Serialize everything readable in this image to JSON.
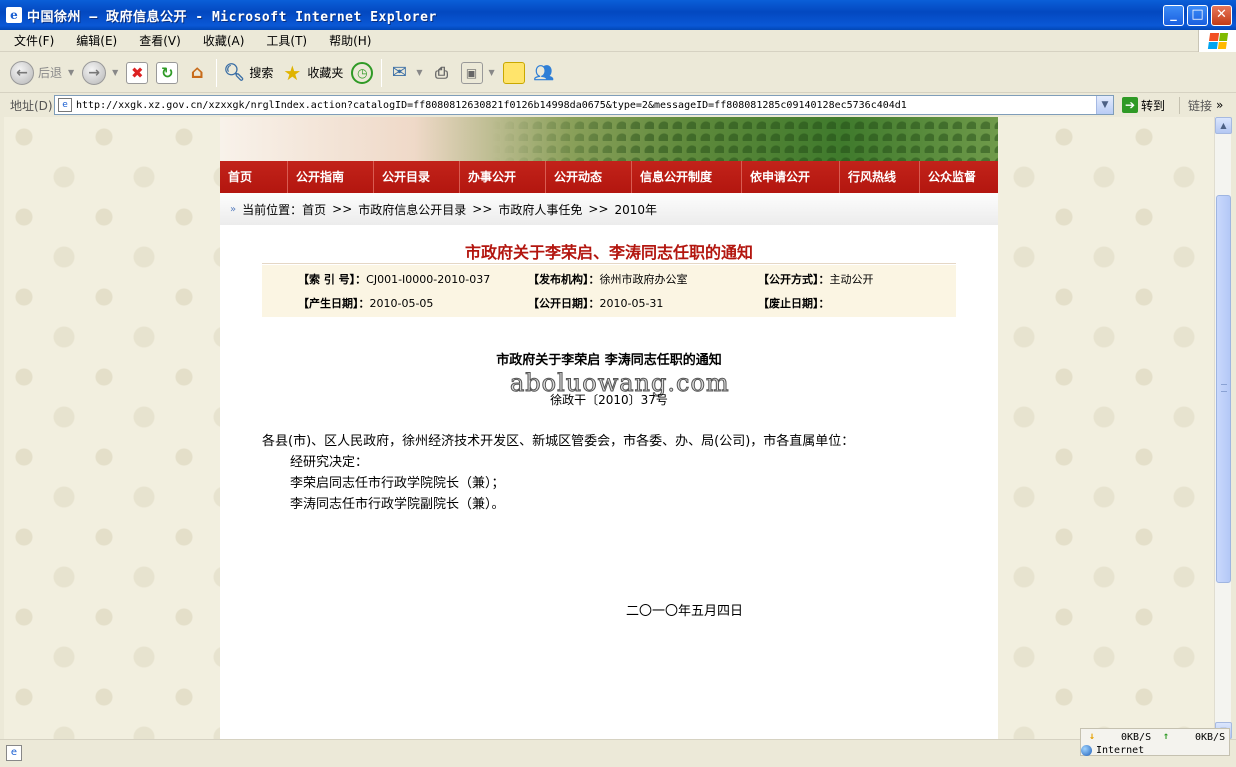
{
  "window": {
    "title": "中国徐州 — 政府信息公开 - Microsoft Internet Explorer"
  },
  "menu": [
    "文件(F)",
    "编辑(E)",
    "查看(V)",
    "收藏(A)",
    "工具(T)",
    "帮助(H)"
  ],
  "toolbar": {
    "back": "后退",
    "search": "搜索",
    "favorites": "收藏夹"
  },
  "address": {
    "label": "地址(D)",
    "url": "http://xxgk.xz.gov.cn/xzxxgk/nrglIndex.action?catalogID=ff8080812630821f0126b14998da0675&type=2&messageID=ff808081285c09140128ec5736c404d1",
    "go": "转到",
    "links": "链接"
  },
  "nav": [
    "首页",
    "公开指南",
    "公开目录",
    "办事公开",
    "公开动态",
    "信息公开制度",
    "依申请公开",
    "行风热线",
    "公众监督"
  ],
  "breadcrumb": {
    "prefix": "当前位置：",
    "items": [
      "首页",
      ">>",
      "市政府信息公开目录",
      ">>",
      "市政府人事任免",
      ">>",
      "2010年"
    ]
  },
  "document": {
    "title": "市政府关于李荣启、李涛同志任职的通知",
    "meta": {
      "index_label": "【索 引 号】：",
      "index_value": "CJ001-I0000-2010-037",
      "publisher_label": "【发布机构】：",
      "publisher_value": "徐州市政府办公室",
      "mode_label": "【公开方式】：",
      "mode_value": "主动公开",
      "created_label": "【产生日期】：",
      "created_value": "2010-05-05",
      "public_label": "【公开日期】：",
      "public_value": "2010-05-31",
      "expire_label": "【废止日期】：",
      "expire_value": ""
    },
    "heading": "市政府关于李荣启 李涛同志任职的通知",
    "watermark": "aboluowang.com",
    "doc_number": "徐政干〔2010〕37号",
    "addressee": "各县(市)、区人民政府，徐州经济技术开发区、新城区管委会，市各委、办、局(公司)，市各直属单位：",
    "lines": [
      "经研究决定：",
      "李荣启同志任市行政学院院长（兼）；",
      "李涛同志任市行政学院副院长（兼）。"
    ],
    "date": "二〇一〇年五月四日"
  },
  "status": {
    "down": "0KB/S",
    "up": "0KB/S",
    "zone": "Internet"
  }
}
